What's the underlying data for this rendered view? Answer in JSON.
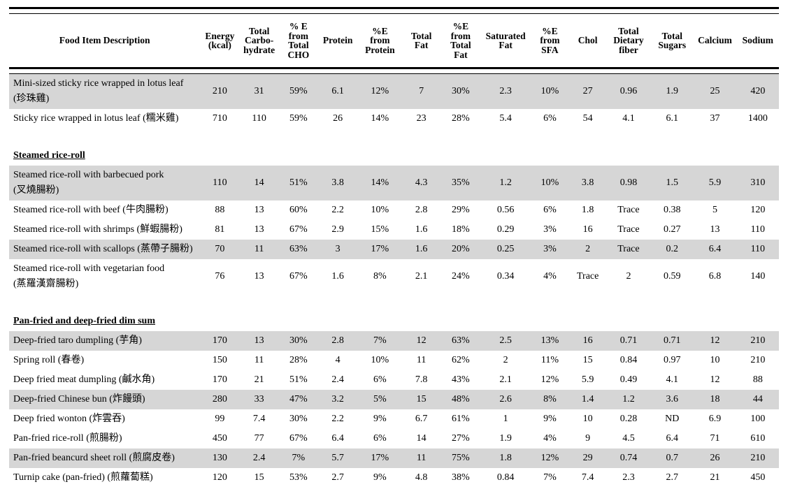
{
  "table": {
    "columns": [
      {
        "key": "desc",
        "label": "Food Item Description"
      },
      {
        "key": "energy",
        "label": "Energy\n(kcal)"
      },
      {
        "key": "carb",
        "label": "Total\nCarbo-\nhydrate"
      },
      {
        "key": "pe_cho",
        "label": "% E\nfrom\nTotal\nCHO"
      },
      {
        "key": "protein",
        "label": "Protein"
      },
      {
        "key": "pe_protein",
        "label": "%E\nfrom\nProtein"
      },
      {
        "key": "fat",
        "label": "Total\nFat"
      },
      {
        "key": "pe_fat",
        "label": "%E\nfrom\nTotal\nFat"
      },
      {
        "key": "satfat",
        "label": "Saturated\nFat"
      },
      {
        "key": "pe_sfa",
        "label": "%E\nfrom\nSFA"
      },
      {
        "key": "chol",
        "label": "Chol"
      },
      {
        "key": "fiber",
        "label": "Total\nDietary\nfiber"
      },
      {
        "key": "sugars",
        "label": "Total\nSugars"
      },
      {
        "key": "calcium",
        "label": "Calcium"
      },
      {
        "key": "sodium",
        "label": "Sodium"
      }
    ],
    "rows": [
      {
        "type": "data",
        "shaded": true,
        "twoline": true,
        "name_en": "Mini-sized sticky rice wrapped in lotus leaf",
        "name_cn": "(珍珠雞)",
        "values": [
          "210",
          "31",
          "59%",
          "6.1",
          "12%",
          "7",
          "30%",
          "2.3",
          "10%",
          "27",
          "0.96",
          "1.9",
          "25",
          "420"
        ]
      },
      {
        "type": "data",
        "shaded": false,
        "twoline": false,
        "name_en": "Sticky rice wrapped in lotus leaf",
        "name_cn": "(糯米雞)",
        "values": [
          "710",
          "110",
          "59%",
          "26",
          "14%",
          "23",
          "28%",
          "5.4",
          "6%",
          "54",
          "4.1",
          "6.1",
          "37",
          "1400"
        ]
      },
      {
        "type": "spacer"
      },
      {
        "type": "section",
        "label": "Steamed rice-roll"
      },
      {
        "type": "data",
        "shaded": true,
        "twoline": true,
        "name_en": "Steamed rice-roll with barbecued pork",
        "name_cn": "(叉燒腸粉)",
        "values": [
          "110",
          "14",
          "51%",
          "3.8",
          "14%",
          "4.3",
          "35%",
          "1.2",
          "10%",
          "3.8",
          "0.98",
          "1.5",
          "5.9",
          "310"
        ]
      },
      {
        "type": "data",
        "shaded": false,
        "twoline": false,
        "name_en": "Steamed rice-roll with beef",
        "name_cn": "(牛肉腸粉)",
        "values": [
          "88",
          "13",
          "60%",
          "2.2",
          "10%",
          "2.8",
          "29%",
          "0.56",
          "6%",
          "1.8",
          "Trace",
          "0.38",
          "5",
          "120"
        ]
      },
      {
        "type": "data",
        "shaded": false,
        "twoline": false,
        "name_en": "Steamed rice-roll with shrimps",
        "name_cn": "(鮮蝦腸粉)",
        "values": [
          "81",
          "13",
          "67%",
          "2.9",
          "15%",
          "1.6",
          "18%",
          "0.29",
          "3%",
          "16",
          "Trace",
          "0.27",
          "13",
          "110"
        ]
      },
      {
        "type": "data",
        "shaded": true,
        "twoline": false,
        "name_en": "Steamed rice-roll with scallops",
        "name_cn": "(蒸帶子腸粉)",
        "values": [
          "70",
          "11",
          "63%",
          "3",
          "17%",
          "1.6",
          "20%",
          "0.25",
          "3%",
          "2",
          "Trace",
          "0.2",
          "6.4",
          "110"
        ]
      },
      {
        "type": "data",
        "shaded": false,
        "twoline": true,
        "name_en": "Steamed rice-roll with vegetarian food",
        "name_cn": "(蒸羅漢齋腸粉)",
        "values": [
          "76",
          "13",
          "67%",
          "1.6",
          "8%",
          "2.1",
          "24%",
          "0.34",
          "4%",
          "Trace",
          "2",
          "0.59",
          "6.8",
          "140"
        ]
      },
      {
        "type": "spacer"
      },
      {
        "type": "section",
        "label": "Pan-fried and deep-fried dim sum"
      },
      {
        "type": "data",
        "shaded": true,
        "twoline": false,
        "name_en": "Deep-fried taro dumpling",
        "name_cn": "(芋角)",
        "values": [
          "170",
          "13",
          "30%",
          "2.8",
          "7%",
          "12",
          "63%",
          "2.5",
          "13%",
          "16",
          "0.71",
          "0.71",
          "12",
          "210"
        ]
      },
      {
        "type": "data",
        "shaded": false,
        "twoline": false,
        "name_en": "Spring roll",
        "name_cn": "(春卷)",
        "values": [
          "150",
          "11",
          "28%",
          "4",
          "10%",
          "11",
          "62%",
          "2",
          "11%",
          "15",
          "0.84",
          "0.97",
          "10",
          "210"
        ]
      },
      {
        "type": "data",
        "shaded": false,
        "twoline": false,
        "name_en": "Deep fried meat dumpling",
        "name_cn": "(鹹水角)",
        "values": [
          "170",
          "21",
          "51%",
          "2.4",
          "6%",
          "7.8",
          "43%",
          "2.1",
          "12%",
          "5.9",
          "0.49",
          "4.1",
          "12",
          "88"
        ]
      },
      {
        "type": "data",
        "shaded": true,
        "twoline": false,
        "name_en": "Deep-fried Chinese bun",
        "name_cn": "(炸饅頭)",
        "values": [
          "280",
          "33",
          "47%",
          "3.2",
          "5%",
          "15",
          "48%",
          "2.6",
          "8%",
          "1.4",
          "1.2",
          "3.6",
          "18",
          "44"
        ]
      },
      {
        "type": "data",
        "shaded": false,
        "twoline": false,
        "name_en": "Deep fried wonton",
        "name_cn": "(炸雲吞)",
        "values": [
          "99",
          "7.4",
          "30%",
          "2.2",
          "9%",
          "6.7",
          "61%",
          "1",
          "9%",
          "10",
          "0.28",
          "ND",
          "6.9",
          "100"
        ]
      },
      {
        "type": "data",
        "shaded": false,
        "twoline": false,
        "name_en": "Pan-fried rice-roll",
        "name_cn": "(煎腸粉)",
        "values": [
          "450",
          "77",
          "67%",
          "6.4",
          "6%",
          "14",
          "27%",
          "1.9",
          "4%",
          "9",
          "4.5",
          "6.4",
          "71",
          "610"
        ]
      },
      {
        "type": "data",
        "shaded": true,
        "twoline": false,
        "name_en": "Pan-fried beancurd sheet roll",
        "name_cn": "(煎腐皮卷)",
        "values": [
          "130",
          "2.4",
          "7%",
          "5.7",
          "17%",
          "11",
          "75%",
          "1.8",
          "12%",
          "29",
          "0.74",
          "0.7",
          "26",
          "210"
        ]
      },
      {
        "type": "data",
        "shaded": false,
        "twoline": false,
        "name_en": "Turnip cake (pan-fried)",
        "name_cn": "(煎蘿蔔糕)",
        "values": [
          "120",
          "15",
          "53%",
          "2.7",
          "9%",
          "4.8",
          "38%",
          "0.84",
          "7%",
          "7.4",
          "2.3",
          "2.7",
          "21",
          "450"
        ]
      }
    ]
  },
  "style": {
    "shade_color": "#d6d6d6",
    "rule_color": "#000000",
    "text_color": "#000000"
  }
}
